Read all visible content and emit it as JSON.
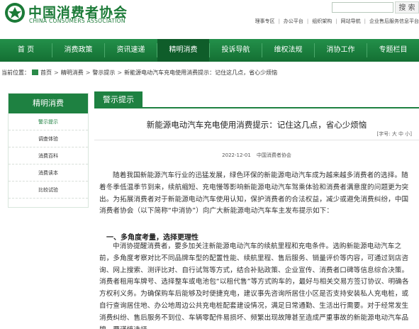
{
  "header": {
    "logo_cn": "中国消费者协会",
    "logo_en": "CHINA CONSUMERS ASSOCIATION",
    "search_button": "搜 索",
    "top_links": [
      "理事专区",
      "办公平台",
      "组织架构",
      "网站导航",
      "企业售后服务信息平台"
    ]
  },
  "nav": {
    "items": [
      "首  页",
      "消费政策",
      "资讯速递",
      "精明消费",
      "投诉导航",
      "维权法规",
      "消协工作",
      "专题栏目"
    ],
    "active_index": 3
  },
  "breadcrumb": {
    "prefix": "当前位置：",
    "items": [
      "首页",
      "精明消费",
      "警示提示",
      "新能源电动汽车充电使用消费提示：记住这几点，省心少烦恼"
    ]
  },
  "sidebar": {
    "title": "精明消费",
    "items": [
      "警示提示",
      "调查体验",
      "消费百科",
      "消费读本",
      "比较试验"
    ],
    "active_index": 0
  },
  "main": {
    "tab_label": "警示提示",
    "title": "新能源电动汽车充电使用消费提示：记住这几点，省心少烦恼",
    "font_size_label": "[字号: 大 中 小]",
    "date": "2022-12-01",
    "source": "中国消费者协会",
    "para1": "随着我国新能源汽车行业的迅猛发展，绿色环保的新能源电动汽车成为越来越多消费者的选择。随着冬季低温季节到来，续航缩短、充电慢等影响新能源电动汽车驾乘体验和消费者满意度的问题更为突出。为拓展消费者对于新能源电动汽车使用认知，保护消费者的合法权益，减少或避免消费纠纷，中国消费者协会（以下简称“中消协”）向广大新能源电动汽车车主发布提示如下：",
    "heading1": "一、多角度考量，选择更理性",
    "para2": "中消协提醒消费者，要多加关注新能源电动汽车的续航里程和充电条件。选购新能源电动汽车之前，多角度考察对比不同品牌车型的配置性能、续航里程、售后服务、销量评价等内容，可通过到店咨询、网上搜索、测评比对、自行试驾等方式，结合补贴政策、企业宣传、消费者口碑等信息综合决策。消费者租用车牌号、选择整车或电池包“以租代售”等方式购车的，最好与相关交易方签订协议、明确各方权利义务。为确保购车后能够及时便捷充电，建议事先咨询所居住小区是否支持安装私人充电桩，或自行查询居住地、办公地周边公共充电桩配套建设情况，满足日常通勤、生活出行需要。对于经常发生消费纠纷、售后服务不到位、车辆零配件易损坏、频繁出现故障甚至造成严重事故的新能源电动汽车品牌，要谨慎选择。"
  },
  "colors": {
    "brand_green": "#1e8141",
    "nav_active": "#0f5d2a"
  }
}
